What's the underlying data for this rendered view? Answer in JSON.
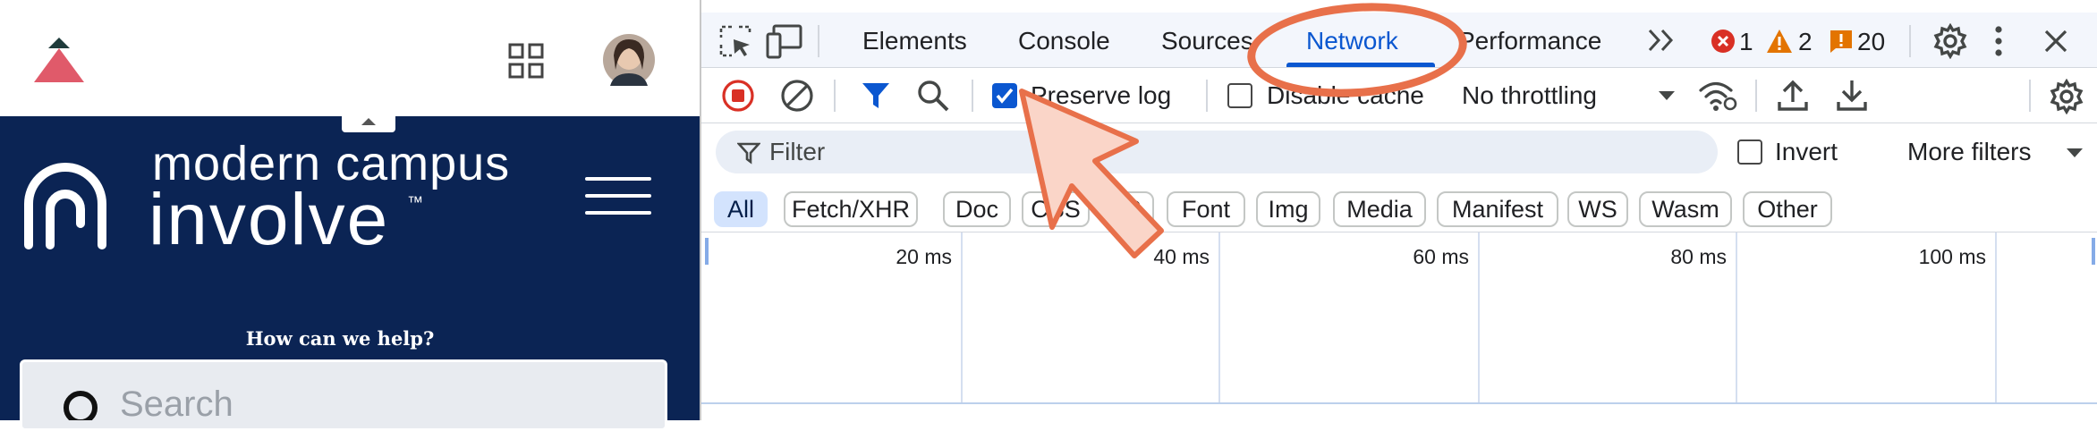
{
  "site": {
    "brand_top": "modern campus",
    "brand_bottom": "involve",
    "trademark": "™",
    "help_heading": "How can we help?",
    "search_placeholder": "Search"
  },
  "devtools": {
    "tabs": [
      "Elements",
      "Console",
      "Sources",
      "Network",
      "Performance"
    ],
    "active_tab": "Network",
    "more_tabs_icon": "double-chevron-icon",
    "counts": {
      "errors": "1",
      "warnings": "2",
      "issues": "20"
    },
    "toolbar": {
      "preserve_log": "Preserve log",
      "preserve_log_checked": true,
      "disable_cache": "Disable cache",
      "disable_cache_checked": false,
      "throttling": "No throttling"
    },
    "filter": {
      "placeholder": "Filter",
      "invert": "Invert",
      "more_filters": "More filters"
    },
    "type_filters": [
      "All",
      "Fetch/XHR",
      "Doc",
      "CSS",
      "JS",
      "Font",
      "Img",
      "Media",
      "Manifest",
      "WS",
      "Wasm",
      "Other"
    ],
    "selected_type": "All",
    "timeline_ticks": [
      "20 ms",
      "40 ms",
      "60 ms",
      "80 ms",
      "100 ms"
    ]
  },
  "colors": {
    "hero_background": "#0b2454",
    "active_tab": "#0b57d0",
    "annotation": "#e8704a",
    "record": "#d93025",
    "error": "#d93025",
    "warning": "#e37400"
  }
}
